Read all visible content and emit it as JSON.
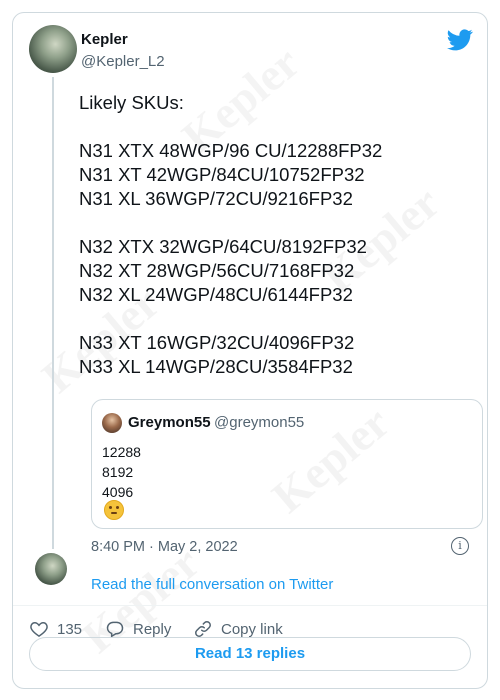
{
  "author": {
    "name": "Kepler",
    "handle": "@Kepler_L2"
  },
  "tweet": {
    "lines": [
      "Likely SKUs:",
      "",
      "N31 XTX 48WGP/96 CU/12288FP32",
      "N31 XT 42WGP/84CU/10752FP32",
      "N31 XL 36WGP/72CU/9216FP32",
      "",
      "N32 XTX 32WGP/64CU/8192FP32",
      "N32 XT 28WGP/56CU/7168FP32",
      "N32 XL 24WGP/48CU/6144FP32",
      "",
      "N33 XT 16WGP/32CU/4096FP32",
      "N33 XL 14WGP/28CU/3584FP32"
    ],
    "timestamp": "8:40 PM · May 2, 2022"
  },
  "quote": {
    "name": "Greymon55",
    "handle": "@greymon55",
    "lines": [
      "12288",
      "8192",
      "4096"
    ],
    "emoji": "thinking-face-emoji"
  },
  "read_conversation": "Read the full conversation on Twitter",
  "actions": {
    "like_count": "135",
    "reply_label": "Reply",
    "copy_label": "Copy link"
  },
  "read_replies": "Read 13 replies",
  "watermark": "Kepler",
  "colors": {
    "accent": "#1d9bf0",
    "secondary_text": "#536471",
    "border": "#cfd9de"
  },
  "icons": [
    "twitter-bird-icon",
    "info-icon",
    "heart-icon",
    "reply-bubble-icon",
    "link-icon"
  ]
}
